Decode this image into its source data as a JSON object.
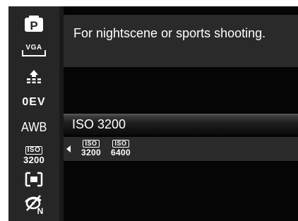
{
  "sidebar": {
    "items": [
      {
        "icon": "program-mode-icon",
        "label": "P"
      },
      {
        "icon": "resolution-vga-icon",
        "label": "VGA"
      },
      {
        "icon": "quality-icon",
        "label": ""
      },
      {
        "icon": "exposure-value-icon",
        "label": "0EV"
      },
      {
        "icon": "white-balance-icon",
        "label": "AWB"
      },
      {
        "icon": "iso-setting-icon",
        "label_top": "ISO",
        "label_bottom": "3200"
      },
      {
        "icon": "metering-icon",
        "label": ""
      },
      {
        "icon": "color-mode-icon",
        "label": "N"
      }
    ]
  },
  "description": {
    "text": "For nightscene or sports shooting."
  },
  "selected": {
    "label": "ISO 3200"
  },
  "options": [
    {
      "top": "ISO",
      "bottom": "3200"
    },
    {
      "top": "ISO",
      "bottom": "6400"
    }
  ],
  "colors": {
    "screen_bg": "#050505",
    "sidebar_bg": "#262626",
    "panel_bg": "#2a2a2a",
    "text": "#ffffff"
  }
}
